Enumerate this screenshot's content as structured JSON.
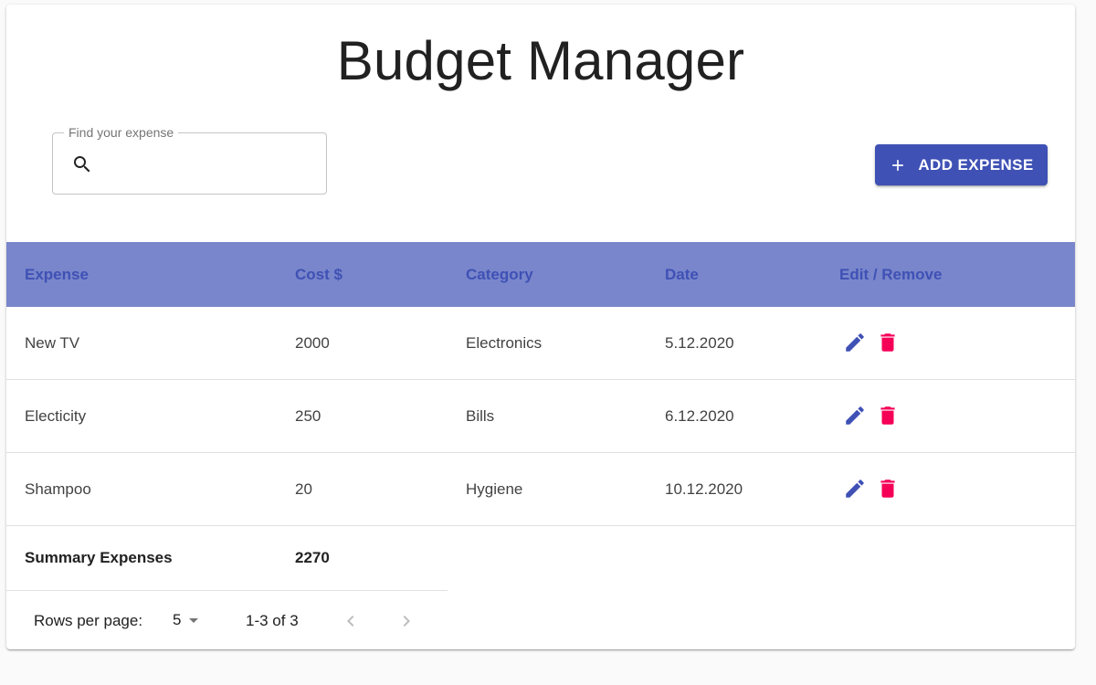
{
  "app": {
    "title": "Budget Manager"
  },
  "search": {
    "label": "Find your expense",
    "value": "",
    "placeholder": ""
  },
  "toolbar": {
    "add_label": "ADD EXPENSE"
  },
  "table": {
    "headers": [
      "Expense",
      "Cost $",
      "Category",
      "Date",
      "Edit / Remove"
    ],
    "rows": [
      {
        "expense": "New TV",
        "cost": "2000",
        "category": "Electronics",
        "date": "5.12.2020"
      },
      {
        "expense": "Electicity",
        "cost": "250",
        "category": "Bills",
        "date": "6.12.2020"
      },
      {
        "expense": "Shampoo",
        "cost": "20",
        "category": "Hygiene",
        "date": "10.12.2020"
      }
    ],
    "summary": {
      "label": "Summary Expenses",
      "total": "2270"
    }
  },
  "pagination": {
    "rows_label": "Rows per page:",
    "rows_value": "5",
    "page_info": "1-3 of 3"
  },
  "icons": {
    "search": "search-icon",
    "add": "plus-icon",
    "edit": "pencil-icon",
    "remove": "trash-icon",
    "dropdown": "caret-down-icon",
    "prev": "chevron-left-icon",
    "next": "chevron-right-icon"
  },
  "colors": {
    "primary": "#3f51b5",
    "header_bg": "#7986cb",
    "danger": "#f50057",
    "disabled": "#bdbdbd"
  }
}
